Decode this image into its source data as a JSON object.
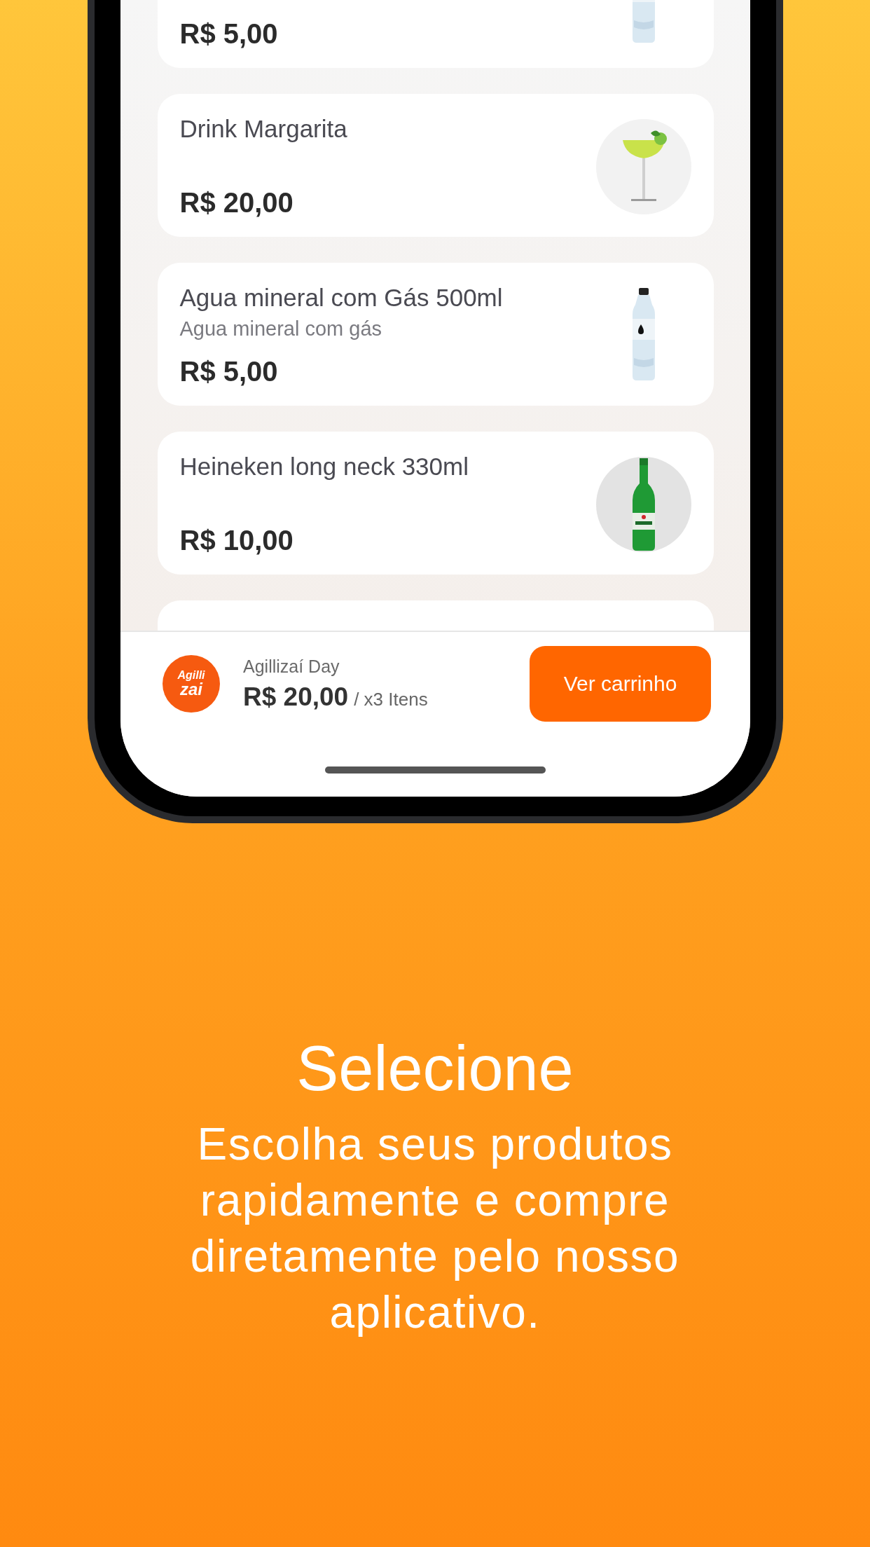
{
  "products": [
    {
      "price": "R$ 5,00"
    },
    {
      "title": "Drink Margarita",
      "price": "R$ 20,00"
    },
    {
      "title": "Agua mineral com Gás 500ml",
      "description": "Agua mineral com gás",
      "price": "R$ 5,00"
    },
    {
      "title": "Heineken long neck 330ml",
      "price": "R$ 10,00"
    }
  ],
  "cart_bar": {
    "logo": {
      "line_1": "Agilli",
      "line_2": "zai"
    },
    "store_name": "Agillizaí Day",
    "total": "R$ 20,00",
    "count": "/ x3 Itens",
    "button": "Ver carrinho"
  },
  "promo": {
    "title": "Selecione",
    "description": "Escolha seus produtos rapidamente e compre diretamente pelo nosso aplicativo."
  }
}
